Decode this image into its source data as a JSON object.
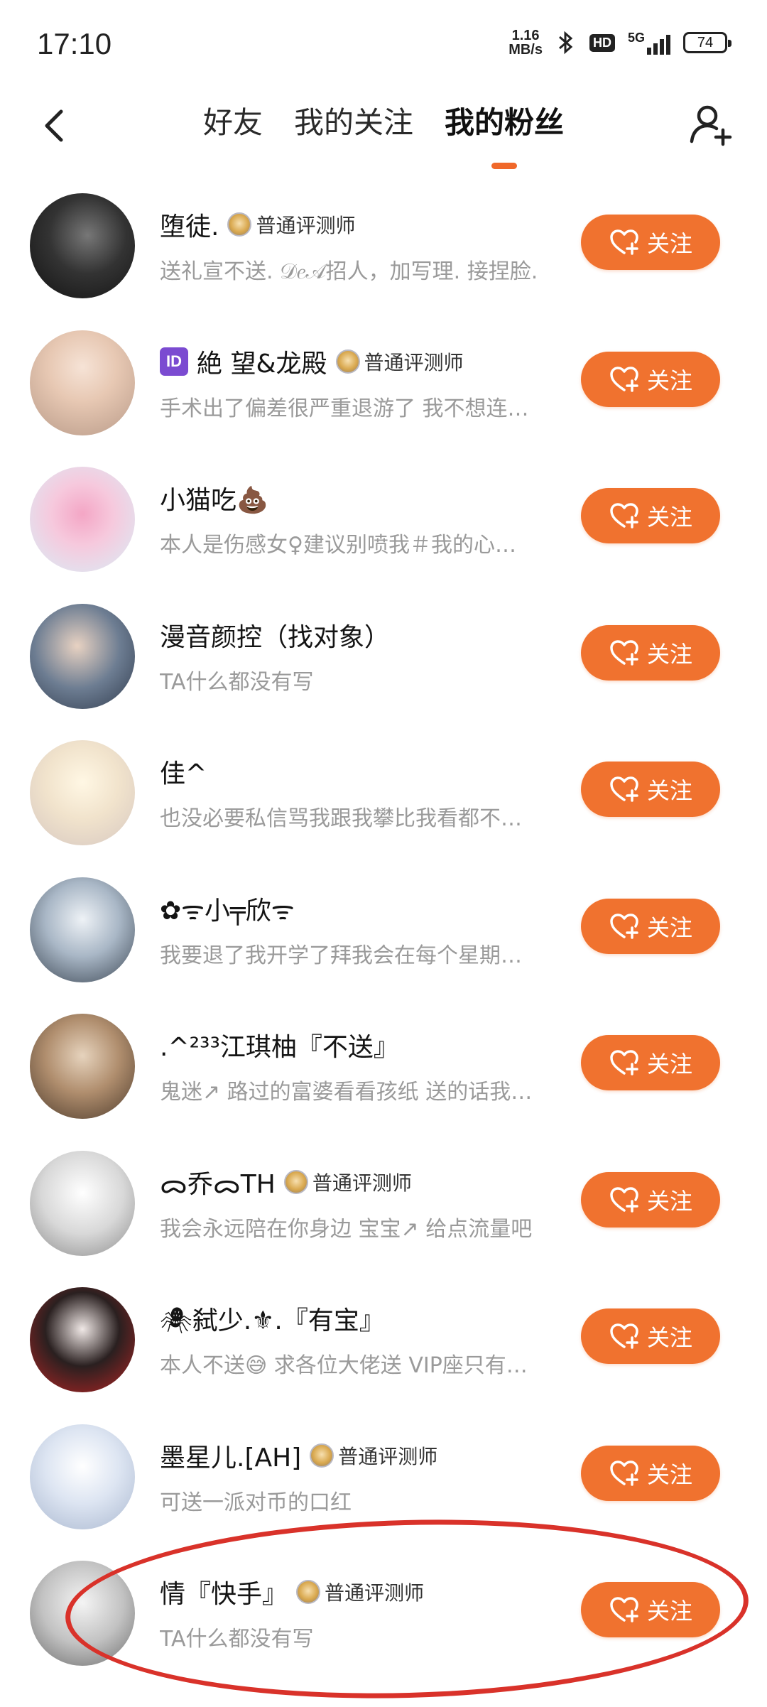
{
  "status_bar": {
    "time": "17:10",
    "net_speed_value": "1.16",
    "net_speed_unit": "MB/s",
    "hd": "HD",
    "network": "5G",
    "battery": "74"
  },
  "header": {
    "tabs": [
      {
        "label": "好友",
        "active": false
      },
      {
        "label": "我的关注",
        "active": false
      },
      {
        "label": "我的粉丝",
        "active": true
      }
    ]
  },
  "colors": {
    "accent": "#f0722f",
    "annotation": "#d9322a"
  },
  "follow_label": "关注",
  "reviewer_label": "普通评测师",
  "fans": [
    {
      "name": "堕徒.",
      "badge_id": false,
      "reviewer": true,
      "bio": "送礼宣不送. 𝒟𝑒𝒜招人，加写理. 接捏脸."
    },
    {
      "name": "絶 望&龙殿",
      "badge_id": true,
      "badge_label": "ID",
      "reviewer": true,
      "bio": "手术出了偏差很严重退游了 我不想连…"
    },
    {
      "name": "小猫吃💩",
      "badge_id": false,
      "reviewer": false,
      "bio": "本人是伤感女♀建议别喷我＃我的心…"
    },
    {
      "name": "漫音颜控（找对象）",
      "badge_id": false,
      "reviewer": false,
      "bio": "TA什么都没有写"
    },
    {
      "name": "佳^",
      "badge_id": false,
      "reviewer": false,
      "bio": "也没必要私信骂我跟我攀比我看都不…"
    },
    {
      "name": "✿ᯤ小╤欣ᯤ",
      "badge_id": false,
      "reviewer": false,
      "bio": "我要退了我开学了拜我会在每个星期…"
    },
    {
      "name": ".^²³³江琪柚『不送』",
      "badge_id": false,
      "reviewer": false,
      "bio": "鬼迷↗ 路过的富婆看看孩纸 送的话我…"
    },
    {
      "name": "ᯅ乔ᯅTH",
      "badge_id": false,
      "reviewer": true,
      "bio": "我会永远陪在你身边 宝宝↗ 给点流量吧"
    },
    {
      "name": "🕷弑少.⚜.『有宝』",
      "badge_id": false,
      "reviewer": false,
      "bio": "本人不送😅 求各位大佬送 VIP座只有…"
    },
    {
      "name": "墨星儿.[AH]",
      "badge_id": false,
      "reviewer": true,
      "bio": "可送一派对币的口红"
    },
    {
      "name": "情『快手』",
      "badge_id": false,
      "reviewer": true,
      "bio": "TA什么都没有写"
    }
  ]
}
